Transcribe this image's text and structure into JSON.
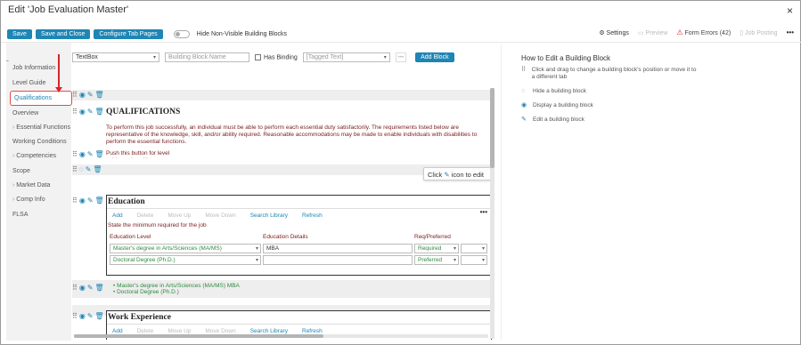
{
  "window": {
    "title": "Edit 'Job Evaluation Master'",
    "close": "×"
  },
  "toolbar": {
    "save": "Save",
    "save_close": "Save and Close",
    "configure_tabs": "Configure Tab Pages",
    "hide_toggle_label": "Hide Non-Visible Building Blocks"
  },
  "topright": {
    "settings": "Settings",
    "preview": "Preview",
    "form_errors": "Form Errors (42)",
    "job_posting": "Job Posting",
    "more": "•••"
  },
  "sidebar": {
    "items": [
      {
        "label": "Job Information"
      },
      {
        "label": "Level Guide"
      },
      {
        "label": "Qualifications"
      },
      {
        "label": "Overview"
      },
      {
        "label": "Essential Functions"
      },
      {
        "label": "Working Conditions"
      },
      {
        "label": "Competencies"
      },
      {
        "label": "Scope"
      },
      {
        "label": "Market Data"
      },
      {
        "label": "Comp Info"
      },
      {
        "label": "FLSA"
      }
    ]
  },
  "editor_top": {
    "type_select": "TextBox",
    "name_placeholder": "Building Block Name",
    "has_binding": "Has Binding",
    "tagged_placeholder": "[Tagged Text]",
    "dots": "•••",
    "add_block": "Add Block"
  },
  "qualifications": {
    "heading": "QUALIFICATIONS",
    "paragraph": "To perform this job successfully, an individual must be able to perform each essential duty satisfactorily. The requirements listed below are representative of the knowledge, skill, and/or ability required. Reasonable accommodations may be made to enable individuals with disabilities to perform the essential functions.",
    "push_text": "Push this button for level guidance in writing."
  },
  "tooltip": {
    "prefix": "Click",
    "suffix": "icon to edit"
  },
  "education": {
    "title": "Education",
    "actions": [
      "Add",
      "Delete",
      "Move Up",
      "Move Down",
      "Search Library",
      "Refresh"
    ],
    "instruction": "State the minimum required for the job",
    "columns": [
      "Education Level",
      "Education Details",
      "Req/Preferred"
    ],
    "rows": [
      {
        "level": "Master's degree in Arts/Sciences (MA/MS)",
        "details": "MBA",
        "req": "Required"
      },
      {
        "level": "Doctoral Degree (Ph.D.)",
        "details": "",
        "req": "Preferred"
      }
    ],
    "bullets": [
      "Master's degree in Arts/Sciences (MA/MS) MBA",
      "Doctoral Degree (Ph.D.)"
    ]
  },
  "work_experience": {
    "title": "Work Experience",
    "actions": [
      "Add",
      "Delete",
      "Move Up",
      "Move Down",
      "Search Library",
      "Refresh"
    ]
  },
  "help": {
    "title": "How to Edit a Building Block",
    "items": [
      {
        "icon": "drag-handle-icon",
        "text": "Click and drag to change a building block's position or move it to a different tab"
      },
      {
        "icon": "hide-icon",
        "text": "Hide a building block"
      },
      {
        "icon": "eye-icon",
        "text": "Display a building block"
      },
      {
        "icon": "edit-icon",
        "text": "Edit a building block"
      }
    ]
  },
  "colors": {
    "accent": "#1e85b4",
    "error": "#d9232d",
    "instruction": "#7a1c1c",
    "green": "#2e8b3e"
  }
}
